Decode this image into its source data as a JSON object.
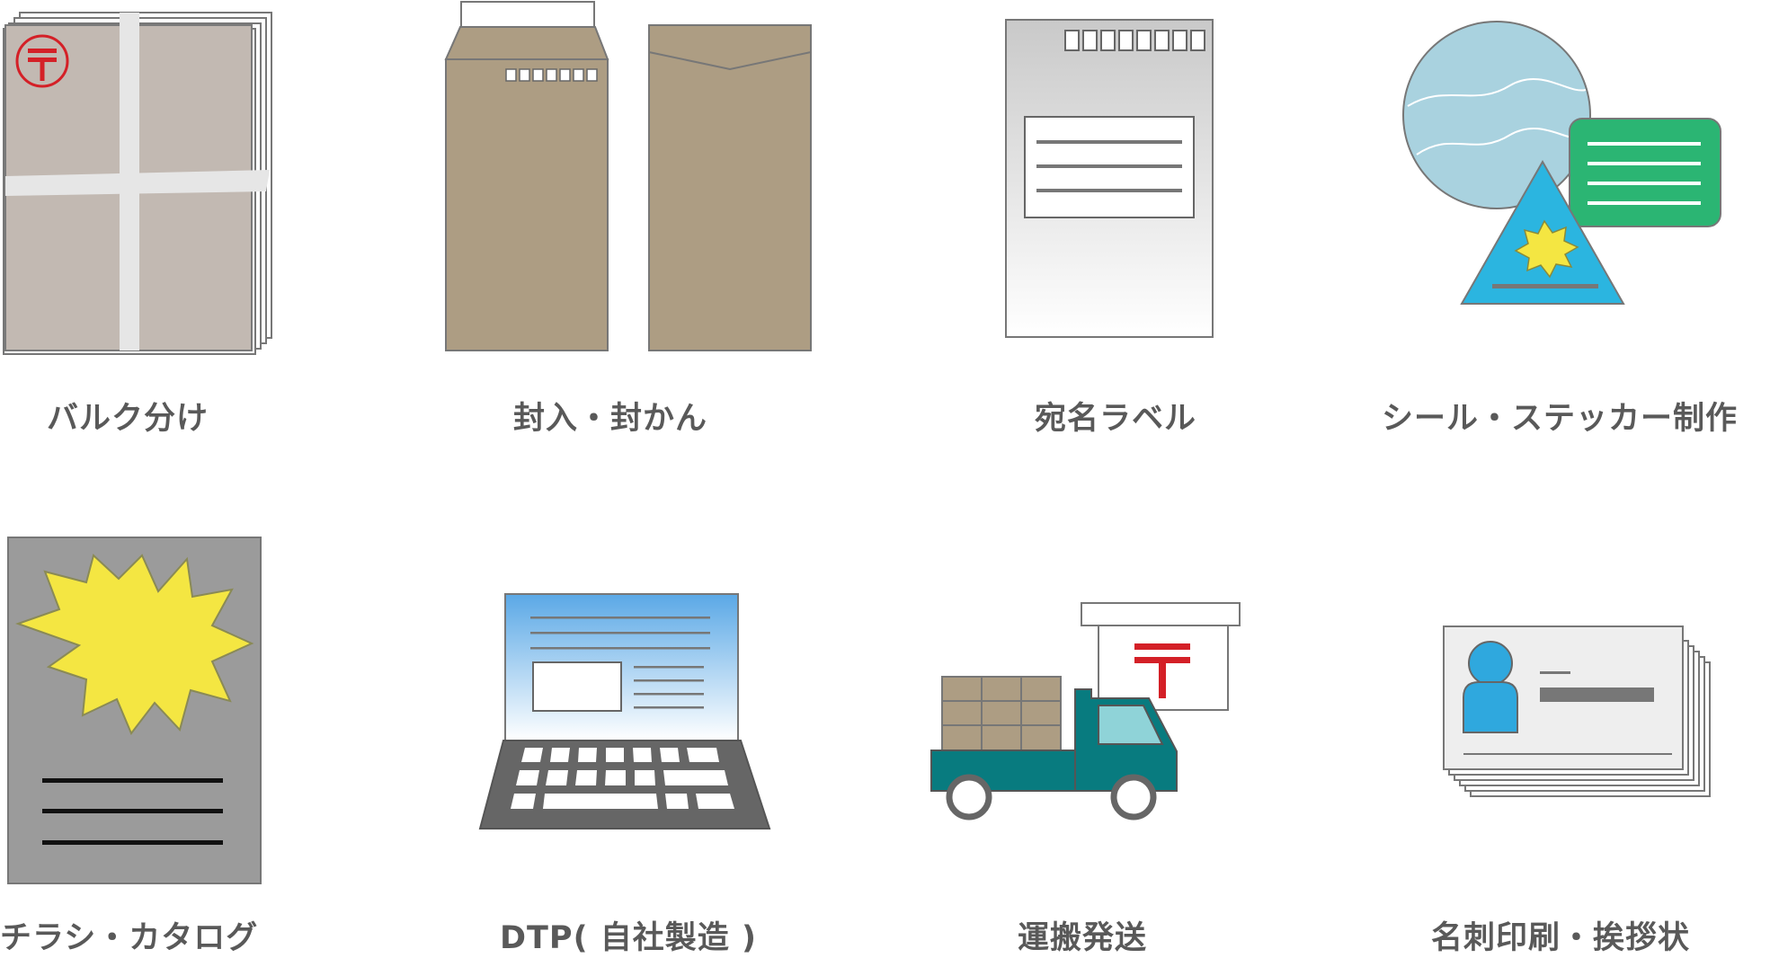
{
  "services": [
    {
      "id": "bulk-sorting",
      "label": "バルク分け"
    },
    {
      "id": "enclosing-sealing",
      "label": "封入・封かん"
    },
    {
      "id": "address-labels",
      "label": "宛名ラベル"
    },
    {
      "id": "seal-sticker",
      "label": "シール・ステッカー制作"
    },
    {
      "id": "flyers-catalogs",
      "label": "チラシ・カタログ"
    },
    {
      "id": "dtp",
      "label": "DTP( 自社製造 )"
    },
    {
      "id": "transport-shipping",
      "label": "運搬発送"
    },
    {
      "id": "business-cards",
      "label": "名刺印刷・挨拶状"
    }
  ],
  "colors": {
    "label_text": "#595959",
    "envelope_kraft": "#ad9d83",
    "bundle_gray": "#c2b9b2",
    "postal_red": "#d42027",
    "sticker_green": "#2bb573",
    "sticker_blue": "#2bb5e0",
    "burst_yellow": "#f4e642",
    "truck_teal": "#087b7f",
    "avatar_blue": "#2fa8de"
  }
}
